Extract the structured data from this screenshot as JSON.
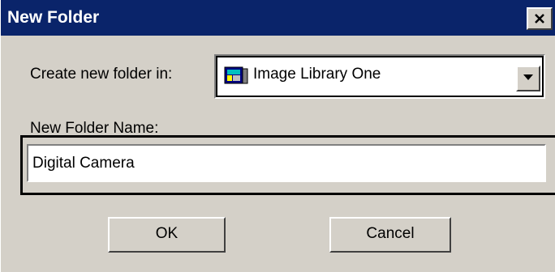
{
  "dialog": {
    "title": "New Folder",
    "close_label": "close"
  },
  "location": {
    "label": "Create new folder in:",
    "selected": "Image Library One",
    "icon": "image-library-icon"
  },
  "folder_name": {
    "label": "New Folder Name:",
    "value": "Digital Camera"
  },
  "buttons": {
    "ok": "OK",
    "cancel": "Cancel"
  },
  "colors": {
    "titlebar": "#0a246a",
    "face": "#d4d0c8"
  }
}
